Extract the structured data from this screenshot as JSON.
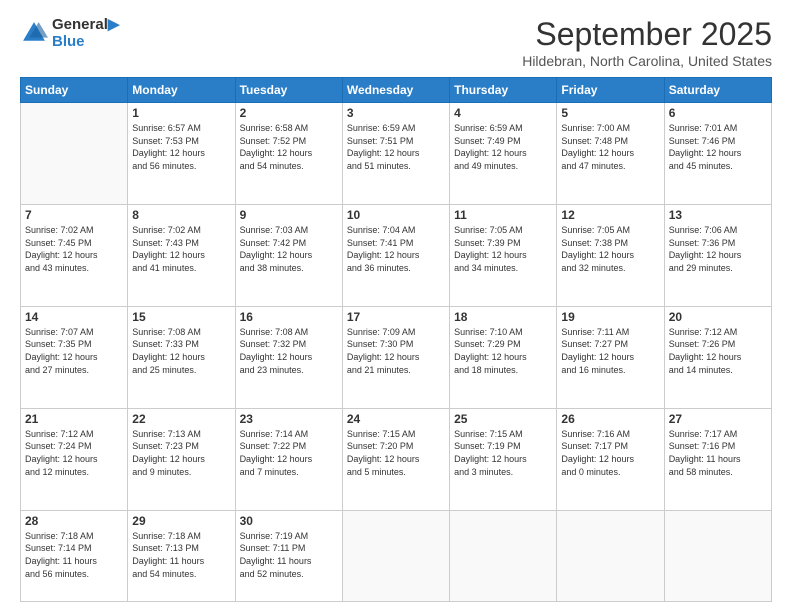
{
  "logo": {
    "line1": "General",
    "line2": "Blue"
  },
  "title": "September 2025",
  "location": "Hildebran, North Carolina, United States",
  "days_header": [
    "Sunday",
    "Monday",
    "Tuesday",
    "Wednesday",
    "Thursday",
    "Friday",
    "Saturday"
  ],
  "weeks": [
    [
      {
        "day": "",
        "info": ""
      },
      {
        "day": "1",
        "info": "Sunrise: 6:57 AM\nSunset: 7:53 PM\nDaylight: 12 hours\nand 56 minutes."
      },
      {
        "day": "2",
        "info": "Sunrise: 6:58 AM\nSunset: 7:52 PM\nDaylight: 12 hours\nand 54 minutes."
      },
      {
        "day": "3",
        "info": "Sunrise: 6:59 AM\nSunset: 7:51 PM\nDaylight: 12 hours\nand 51 minutes."
      },
      {
        "day": "4",
        "info": "Sunrise: 6:59 AM\nSunset: 7:49 PM\nDaylight: 12 hours\nand 49 minutes."
      },
      {
        "day": "5",
        "info": "Sunrise: 7:00 AM\nSunset: 7:48 PM\nDaylight: 12 hours\nand 47 minutes."
      },
      {
        "day": "6",
        "info": "Sunrise: 7:01 AM\nSunset: 7:46 PM\nDaylight: 12 hours\nand 45 minutes."
      }
    ],
    [
      {
        "day": "7",
        "info": "Sunrise: 7:02 AM\nSunset: 7:45 PM\nDaylight: 12 hours\nand 43 minutes."
      },
      {
        "day": "8",
        "info": "Sunrise: 7:02 AM\nSunset: 7:43 PM\nDaylight: 12 hours\nand 41 minutes."
      },
      {
        "day": "9",
        "info": "Sunrise: 7:03 AM\nSunset: 7:42 PM\nDaylight: 12 hours\nand 38 minutes."
      },
      {
        "day": "10",
        "info": "Sunrise: 7:04 AM\nSunset: 7:41 PM\nDaylight: 12 hours\nand 36 minutes."
      },
      {
        "day": "11",
        "info": "Sunrise: 7:05 AM\nSunset: 7:39 PM\nDaylight: 12 hours\nand 34 minutes."
      },
      {
        "day": "12",
        "info": "Sunrise: 7:05 AM\nSunset: 7:38 PM\nDaylight: 12 hours\nand 32 minutes."
      },
      {
        "day": "13",
        "info": "Sunrise: 7:06 AM\nSunset: 7:36 PM\nDaylight: 12 hours\nand 29 minutes."
      }
    ],
    [
      {
        "day": "14",
        "info": "Sunrise: 7:07 AM\nSunset: 7:35 PM\nDaylight: 12 hours\nand 27 minutes."
      },
      {
        "day": "15",
        "info": "Sunrise: 7:08 AM\nSunset: 7:33 PM\nDaylight: 12 hours\nand 25 minutes."
      },
      {
        "day": "16",
        "info": "Sunrise: 7:08 AM\nSunset: 7:32 PM\nDaylight: 12 hours\nand 23 minutes."
      },
      {
        "day": "17",
        "info": "Sunrise: 7:09 AM\nSunset: 7:30 PM\nDaylight: 12 hours\nand 21 minutes."
      },
      {
        "day": "18",
        "info": "Sunrise: 7:10 AM\nSunset: 7:29 PM\nDaylight: 12 hours\nand 18 minutes."
      },
      {
        "day": "19",
        "info": "Sunrise: 7:11 AM\nSunset: 7:27 PM\nDaylight: 12 hours\nand 16 minutes."
      },
      {
        "day": "20",
        "info": "Sunrise: 7:12 AM\nSunset: 7:26 PM\nDaylight: 12 hours\nand 14 minutes."
      }
    ],
    [
      {
        "day": "21",
        "info": "Sunrise: 7:12 AM\nSunset: 7:24 PM\nDaylight: 12 hours\nand 12 minutes."
      },
      {
        "day": "22",
        "info": "Sunrise: 7:13 AM\nSunset: 7:23 PM\nDaylight: 12 hours\nand 9 minutes."
      },
      {
        "day": "23",
        "info": "Sunrise: 7:14 AM\nSunset: 7:22 PM\nDaylight: 12 hours\nand 7 minutes."
      },
      {
        "day": "24",
        "info": "Sunrise: 7:15 AM\nSunset: 7:20 PM\nDaylight: 12 hours\nand 5 minutes."
      },
      {
        "day": "25",
        "info": "Sunrise: 7:15 AM\nSunset: 7:19 PM\nDaylight: 12 hours\nand 3 minutes."
      },
      {
        "day": "26",
        "info": "Sunrise: 7:16 AM\nSunset: 7:17 PM\nDaylight: 12 hours\nand 0 minutes."
      },
      {
        "day": "27",
        "info": "Sunrise: 7:17 AM\nSunset: 7:16 PM\nDaylight: 11 hours\nand 58 minutes."
      }
    ],
    [
      {
        "day": "28",
        "info": "Sunrise: 7:18 AM\nSunset: 7:14 PM\nDaylight: 11 hours\nand 56 minutes."
      },
      {
        "day": "29",
        "info": "Sunrise: 7:18 AM\nSunset: 7:13 PM\nDaylight: 11 hours\nand 54 minutes."
      },
      {
        "day": "30",
        "info": "Sunrise: 7:19 AM\nSunset: 7:11 PM\nDaylight: 11 hours\nand 52 minutes."
      },
      {
        "day": "",
        "info": ""
      },
      {
        "day": "",
        "info": ""
      },
      {
        "day": "",
        "info": ""
      },
      {
        "day": "",
        "info": ""
      }
    ]
  ]
}
